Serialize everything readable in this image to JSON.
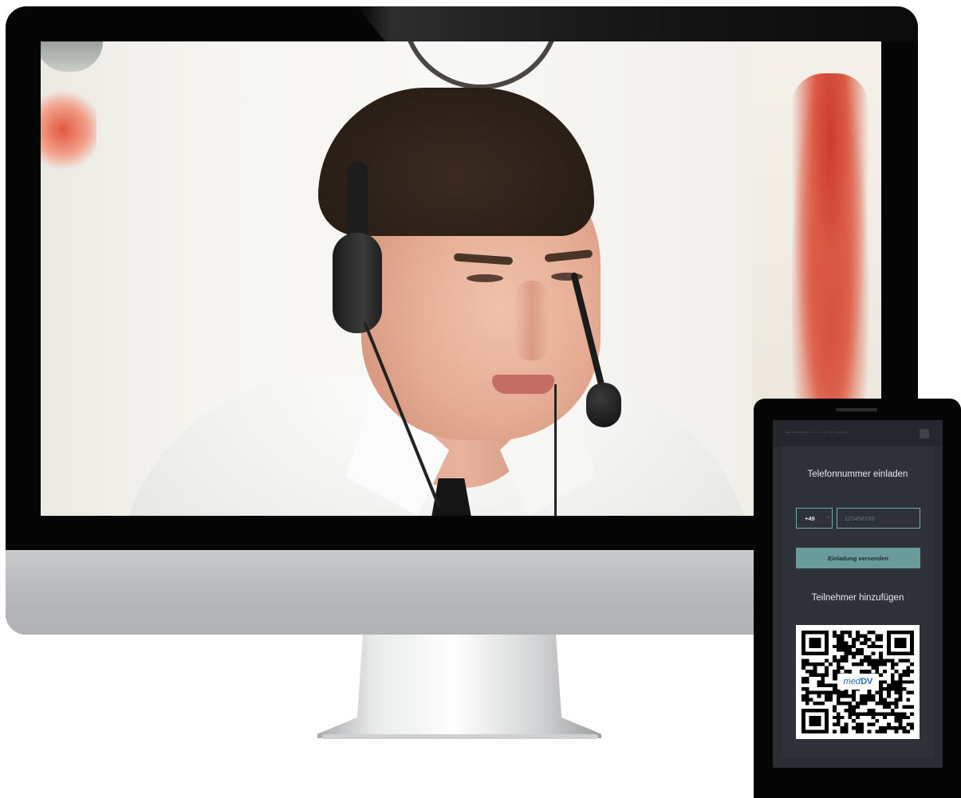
{
  "invite": {
    "title": "Telefonnummer einladen",
    "country_code": "+49",
    "phone_placeholder": "123456789",
    "send_label": "Einladung versenden"
  },
  "participants": {
    "title": "Teilnehmer hinzufügen"
  },
  "qr": {
    "logo_med": "med",
    "logo_dv": "DV"
  },
  "colors": {
    "accent": "#6faeb1",
    "button": "#6a9b9c",
    "panel": "#2e3238"
  },
  "icons": {
    "country_dropdown": "chevron-down-icon",
    "close": "close-icon"
  }
}
